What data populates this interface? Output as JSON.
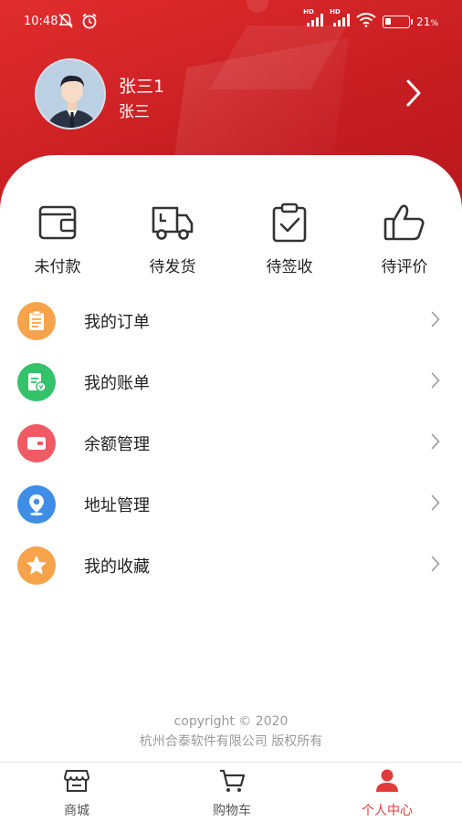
{
  "status_bar": {
    "time": "10:48",
    "battery_percent": "21",
    "battery_suffix": "%",
    "hd1": "HD",
    "hd2": "HD",
    "icons": [
      "mute-icon",
      "alarm-icon",
      "signal-icon",
      "wifi-icon",
      "battery-icon"
    ]
  },
  "profile": {
    "nickname": "张三1",
    "username": "张三"
  },
  "orders": [
    {
      "label": "未付款",
      "icon": "wallet-icon"
    },
    {
      "label": "待发货",
      "icon": "truck-icon"
    },
    {
      "label": "待签收",
      "icon": "clipboard-check-icon"
    },
    {
      "label": "待评价",
      "icon": "thumbs-up-icon"
    }
  ],
  "menu": [
    {
      "label": "我的订单",
      "icon": "order-list-icon",
      "color": "#f6a34b"
    },
    {
      "label": "我的账单",
      "icon": "bill-icon",
      "color": "#34c26a"
    },
    {
      "label": "余额管理",
      "icon": "wallet-card-icon",
      "color": "#ef5a64"
    },
    {
      "label": "地址管理",
      "icon": "location-icon",
      "color": "#3e8ee8"
    },
    {
      "label": "我的收藏",
      "icon": "star-icon",
      "color": "#f6a34b"
    }
  ],
  "footer": {
    "copyright": "copyright © 2020",
    "company": "杭州合泰软件有限公司 版权所有"
  },
  "tabbar": [
    {
      "label": "商城",
      "icon": "store-icon"
    },
    {
      "label": "购物车",
      "icon": "cart-icon"
    },
    {
      "label": "个人中心",
      "icon": "user-icon",
      "active": true
    }
  ],
  "colors": {
    "brand_red": "#d02428",
    "active_tab": "#e23a3a"
  }
}
